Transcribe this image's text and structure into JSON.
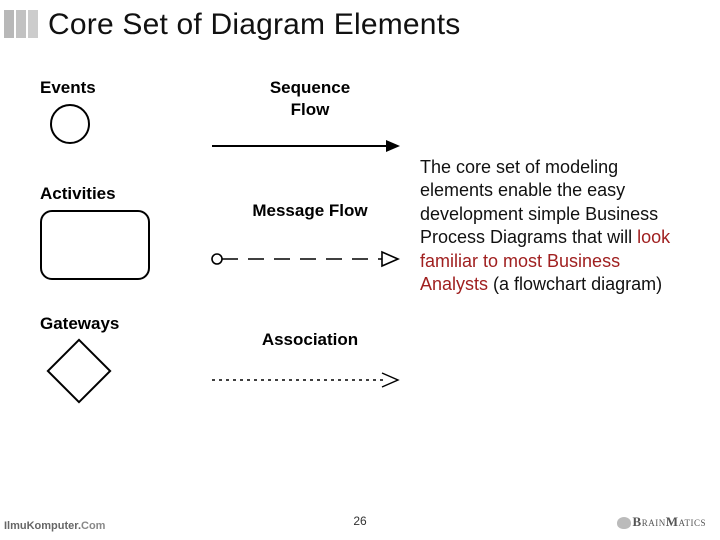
{
  "title": "Core Set of Diagram Elements",
  "labels": {
    "events": "Events",
    "activities": "Activities",
    "gateways": "Gateways",
    "sequence1": "Sequence",
    "sequence2": "Flow",
    "message": "Message Flow",
    "association": "Association"
  },
  "paragraph": {
    "p1": "The core set of modeling elements enable the easy development simple Business Process Diagrams that will ",
    "hl": "look familiar to most Business Analysts",
    "p2": " (a flowchart diagram)"
  },
  "footer": {
    "left_bold": "IlmuKomputer.",
    "left_suffix": "Com",
    "page": "26",
    "right_b": "B",
    "right_rain": "RAIN",
    "right_m": "M",
    "right_atics": "ATICS"
  }
}
